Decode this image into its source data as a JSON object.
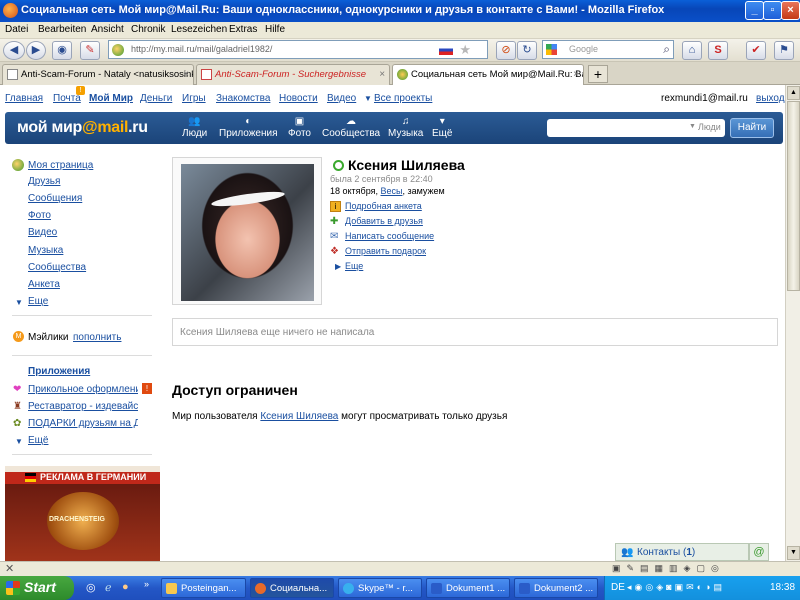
{
  "window": {
    "title": "Социальная сеть Мой мир@Mail.Ru: Ваши одноклассники, однокурсники и друзья в контакте с Вами! - Mozilla Firefox"
  },
  "menu": [
    "Datei",
    "Bearbeiten",
    "Ansicht",
    "Chronik",
    "Lesezeichen",
    "Extras",
    "Hilfe"
  ],
  "toolbar": {
    "url": "http://my.mail.ru/mail/galadriel1982/",
    "search_placeholder": "Google"
  },
  "tabs": [
    {
      "label": "Anti-Scam-Forum - Nataly <natusiksosink...",
      "active": false
    },
    {
      "label": "Anti-Scam-Forum - Suchergebnisse",
      "active": false
    },
    {
      "label": "Социальная сеть Мой мир@Mail.Ru: Ва...",
      "active": true
    }
  ],
  "portal_links": [
    "Главная",
    "Почта",
    "Мой Мир",
    "Деньги",
    "Игры",
    "Знакомства",
    "Новости",
    "Видео",
    "Все проекты"
  ],
  "user": {
    "email": "rexmundi1@mail.ru",
    "logout": "выход"
  },
  "logo": {
    "main": "мой мир",
    "brand": "@mail",
    "suffix": ".ru"
  },
  "mainnav": [
    "Люди",
    "Приложения",
    "Фото",
    "Сообщества",
    "Музыка",
    "Ещё"
  ],
  "people_search": {
    "placeholder": "Люди",
    "button": "Найти"
  },
  "sidebar": {
    "items": [
      "Моя страница",
      "Друзья",
      "Сообщения",
      "Фото",
      "Видео",
      "Музыка",
      "Сообщества",
      "Анкета",
      "Еще"
    ],
    "mailiki": "Мэйлики",
    "mailiki_action": "пополнить",
    "apps_header": "Приложения",
    "apps": [
      "Прикольное оформление",
      "Реставратор - издевайся",
      "ПОДАРКИ друзьям на Д"
    ],
    "apps_more": "Ещё",
    "ad_header": "РЕКЛАМА В ГЕРМАНИИ",
    "ad_label": "DRACHENSTEIG"
  },
  "profile": {
    "name": "Ксения Шиляева",
    "last_seen": "была 2 сентября в 22:40",
    "info_birth": "18 октября,",
    "info_sign": "Весы",
    "info_status": ", замужем",
    "actions": [
      "Подробная анкета",
      "Добавить в друзья",
      "Написать сообщение",
      "Отправить подарок",
      "Еще"
    ],
    "status_text": "Ксения Шиляева еще ничего не написала"
  },
  "restricted": {
    "title": "Доступ ограничен",
    "text_before": "Мир пользователя ",
    "text_link": "Ксения Шиляева",
    "text_after": " могут просматривать только друзья"
  },
  "contacts_bar": {
    "label": "Контакты (",
    "count": "1",
    "close": ")"
  },
  "taskbar": {
    "start": "Start",
    "tasks": [
      {
        "label": "Posteingan...",
        "active": false
      },
      {
        "label": "Социальна...",
        "active": true
      },
      {
        "label": "Skype™ - r...",
        "active": false
      },
      {
        "label": "Dokument1 ...",
        "active": false
      },
      {
        "label": "Dokument2 ...",
        "active": false
      }
    ],
    "lang": "DE",
    "clock": "18:38"
  },
  "colors": {
    "logo_bar": "#1f4a82",
    "link": "#1a4fa0",
    "taskbar": "#2457c6",
    "start": "#3a9a36"
  }
}
